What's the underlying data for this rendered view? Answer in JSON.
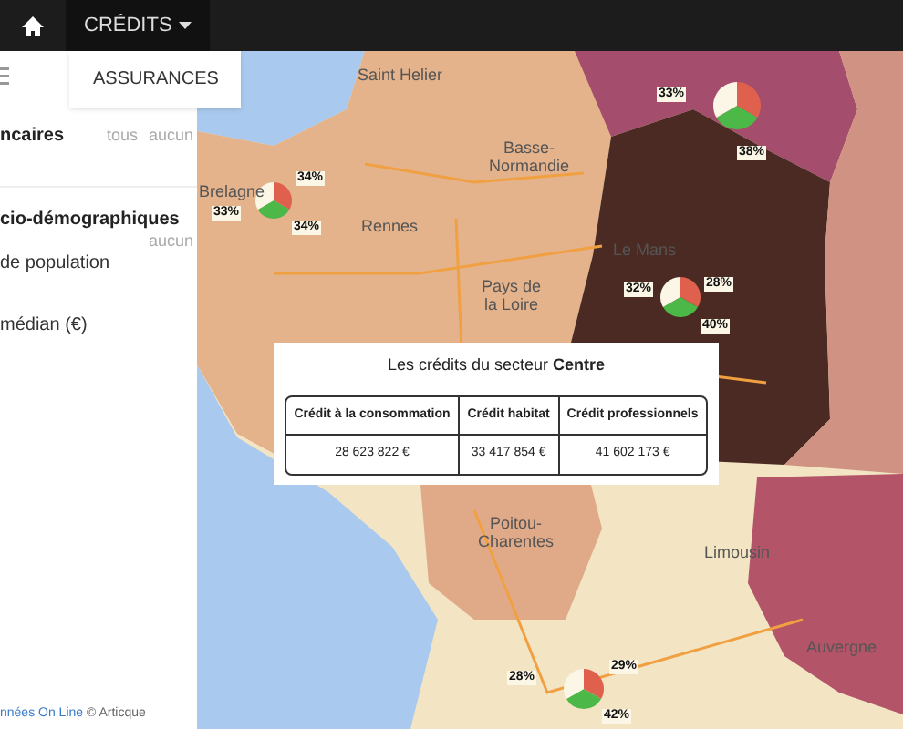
{
  "navbar": {
    "menus": [
      {
        "label": "CRÉDITS",
        "expanded": true
      }
    ],
    "dropdown": [
      "ASSURANCES"
    ]
  },
  "sidebar": {
    "groups": [
      {
        "title": "ncaires",
        "actions": [
          "tous",
          "aucun"
        ]
      },
      {
        "title": "cio-démographiques",
        "actions": [
          "aucun"
        ],
        "items": [
          "de population",
          "médian (€)"
        ]
      }
    ],
    "footer": {
      "link": "nnées On Line",
      "text": "© Articque"
    }
  },
  "map": {
    "labels": [
      "Saint Helier",
      "Basse-\nNormandie",
      "Pays de\nla Loire",
      "Le Mans",
      "Rennes",
      "Poitou-\nCharentes",
      "Limousin",
      "Auvergne",
      "Brelagne"
    ],
    "pies": [
      {
        "labels": [
          "34%",
          "33%",
          "34%"
        ]
      },
      {
        "labels": [
          "33%",
          "38%"
        ]
      },
      {
        "labels": [
          "28%",
          "32%",
          "40%"
        ]
      },
      {
        "labels": [
          "29%",
          "28%",
          "42%"
        ]
      }
    ]
  },
  "popup": {
    "title": "Les crédits du secteur **Centre**",
    "columns": [
      "Crédit à la consommation",
      "Crédit habitat",
      "Crédit professionnels"
    ],
    "row": [
      "28 623 822 €",
      "33 417 854 €",
      "41 602 173 €"
    ]
  }
}
